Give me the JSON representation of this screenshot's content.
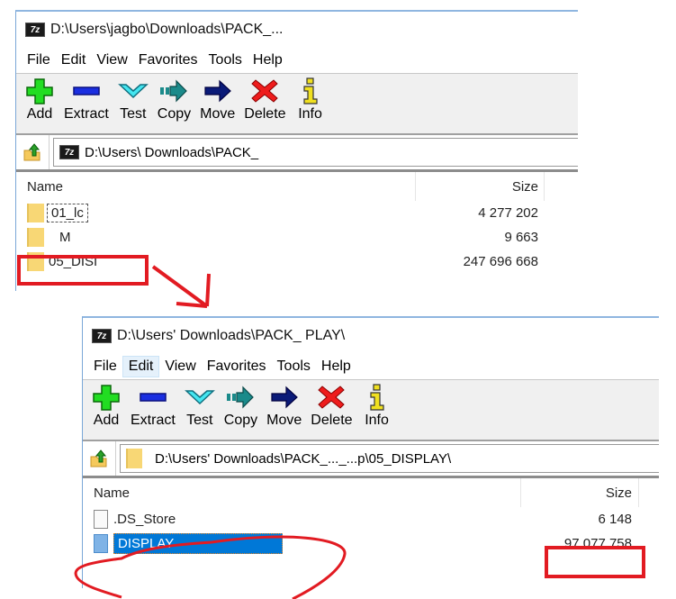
{
  "window1": {
    "title": "D:\\Users\\jagbo\\Downloads\\PACK_...",
    "menu": [
      "File",
      "Edit",
      "View",
      "Favorites",
      "Tools",
      "Help"
    ],
    "toolbar": [
      {
        "label": "Add",
        "icon": "add-icon"
      },
      {
        "label": "Extract",
        "icon": "extract-icon"
      },
      {
        "label": "Test",
        "icon": "test-icon"
      },
      {
        "label": "Copy",
        "icon": "copy-icon"
      },
      {
        "label": "Move",
        "icon": "move-icon"
      },
      {
        "label": "Delete",
        "icon": "delete-icon"
      },
      {
        "label": "Info",
        "icon": "info-icon"
      }
    ],
    "address": "D:\\Users\\      Downloads\\PACK_",
    "columns": {
      "name": "Name",
      "size": "Size"
    },
    "rows": [
      {
        "name": "01_lc",
        "size": "4 277 202",
        "type": "folder"
      },
      {
        "name": "M",
        "size": "9 663",
        "type": "folder"
      },
      {
        "name": "05_DISI",
        "size": "247 696 668",
        "type": "folder"
      }
    ]
  },
  "window2": {
    "title": "D:\\Users'       Downloads\\PACK_                PLAY\\",
    "menu": [
      "File",
      "Edit",
      "View",
      "Favorites",
      "Tools",
      "Help"
    ],
    "highlighted_menu": "Edit",
    "toolbar": [
      {
        "label": "Add",
        "icon": "add-icon"
      },
      {
        "label": "Extract",
        "icon": "extract-icon"
      },
      {
        "label": "Test",
        "icon": "test-icon"
      },
      {
        "label": "Copy",
        "icon": "copy-icon"
      },
      {
        "label": "Move",
        "icon": "move-icon"
      },
      {
        "label": "Delete",
        "icon": "delete-icon"
      },
      {
        "label": "Info",
        "icon": "info-icon"
      }
    ],
    "address": "D:\\Users'        Downloads\\PACK_..._...p\\05_DISPLAY\\",
    "columns": {
      "name": "Name",
      "size": "Size"
    },
    "rows": [
      {
        "name": ".DS_Store",
        "size": "6 148",
        "type": "file"
      },
      {
        "name": "DISPLAY",
        "size": "97 077 758",
        "type": "file",
        "selected": true
      }
    ]
  },
  "annotations": {
    "color": "#e21b22",
    "items": [
      "highlight-box-05-display-folder",
      "arrow-to-second-window",
      "circle-display-file",
      "highlight-box-size"
    ]
  }
}
